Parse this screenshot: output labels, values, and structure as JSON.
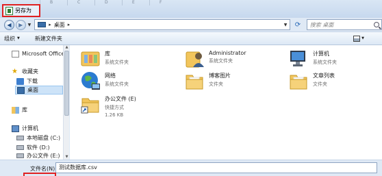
{
  "title": "另存为",
  "address": {
    "path": "桌面",
    "separator": "▸",
    "search_placeholder": "搜索 桌面"
  },
  "toolbar": {
    "organize": "组织",
    "new_folder": "新建文件夹"
  },
  "sidebar": {
    "items": [
      {
        "label": "Microsoft Office",
        "icon": "office-icon"
      },
      {
        "label": "收藏夹",
        "icon": "favorites-star-icon"
      },
      {
        "label": "下载",
        "icon": "downloads-folder-icon"
      },
      {
        "label": "桌面",
        "icon": "desktop-icon",
        "selected": true
      },
      {
        "label": "库",
        "icon": "library-icon"
      },
      {
        "label": "计算机",
        "icon": "computer-icon"
      },
      {
        "label": "本地磁盘 (C:)",
        "icon": "drive-icon"
      },
      {
        "label": "软件 (D:)",
        "icon": "drive-icon"
      },
      {
        "label": "办公文件 (E:)",
        "icon": "drive-icon"
      }
    ]
  },
  "items": [
    {
      "name": "库",
      "sub": "系统文件夹",
      "icon": "library-icon"
    },
    {
      "name": "Administrator",
      "sub": "系统文件夹",
      "icon": "user-icon"
    },
    {
      "name": "计算机",
      "sub": "系统文件夹",
      "icon": "computer-icon"
    },
    {
      "name": "网络",
      "sub": "系统文件夹",
      "icon": "network-globe-icon"
    },
    {
      "name": "博客图片",
      "sub": "文件夹",
      "icon": "folder-icon"
    },
    {
      "name": "文章列表",
      "sub": "文件夹",
      "icon": "folder-icon"
    },
    {
      "name": "办公文件 (E)",
      "sub": "快捷方式",
      "sub2": "1.26 KB",
      "icon": "shortcut-icon"
    }
  ],
  "footer": {
    "filename_label": "文件名(N):",
    "filename_value": "测试数据库.csv"
  },
  "background_columns": [
    "B",
    "C",
    "D",
    "E",
    "F"
  ],
  "colors": {
    "highlight_red": "#e02020",
    "selection": "#cde3f8",
    "folder": "#f2c55c"
  }
}
